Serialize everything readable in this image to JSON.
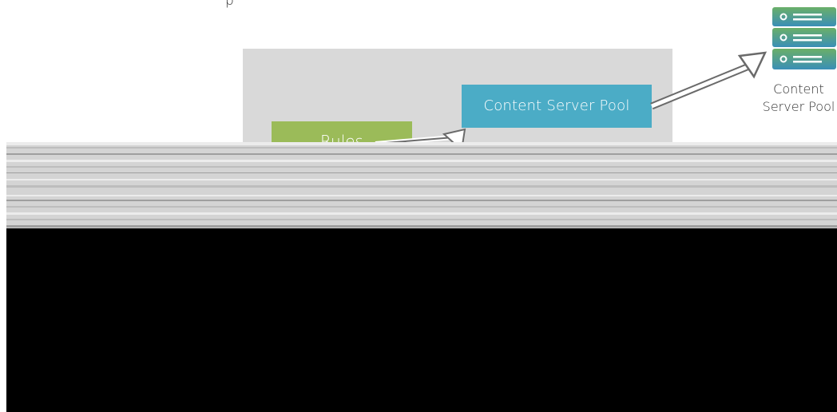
{
  "diagram": {
    "top_text": "p",
    "panel": {
      "rules_label": "Rules",
      "pool_box_label": "Content Server Pool"
    },
    "external_server": {
      "icon": "server-stack-icon",
      "label_line1": "Content",
      "label_line2": "Server Pool"
    }
  },
  "colors": {
    "panel": "#d9d9d9",
    "rules_box": "#9bbb59",
    "pool_box": "#4bacc6",
    "server_icon_gradient_top": "#6aaf68",
    "server_icon_gradient_bottom": "#3a8fb7"
  }
}
